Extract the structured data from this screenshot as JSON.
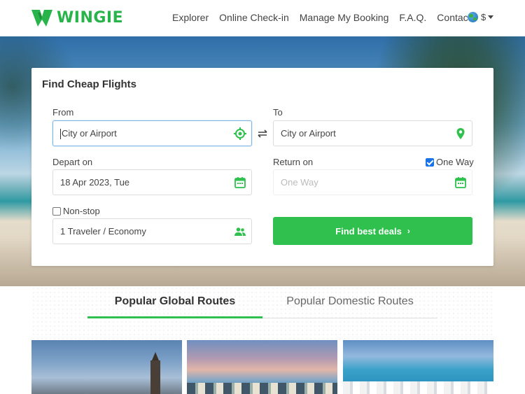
{
  "header": {
    "brand": "WINGIE",
    "nav": [
      "Explorer",
      "Online Check-in",
      "Manage My Booking",
      "F.A.Q.",
      "Contact"
    ],
    "currency": "$"
  },
  "search": {
    "title": "Find Cheap Flights",
    "from_label": "From",
    "from_value": "City or Airport",
    "to_label": "To",
    "to_placeholder": "City or Airport",
    "depart_label": "Depart on",
    "depart_value": "18 Apr 2023, Tue",
    "return_label": "Return on",
    "return_placeholder": "One Way",
    "one_way_label": "One Way",
    "one_way_checked": true,
    "nonstop_label": "Non-stop",
    "nonstop_checked": false,
    "travelers_value": "1 Traveler / Economy",
    "submit_label": "Find best deals"
  },
  "routes": {
    "tabs": [
      "Popular Global Routes",
      "Popular Domestic Routes"
    ],
    "active_tab": 0
  },
  "colors": {
    "brand_green": "#28b44a",
    "button_green": "#2fc04e",
    "active_border": "#7fb6e6"
  },
  "icons": {
    "from": "locate-target-icon",
    "to": "map-pin-icon",
    "swap": "swap-arrows-icon",
    "calendar": "calendar-icon",
    "travelers": "people-icon"
  }
}
